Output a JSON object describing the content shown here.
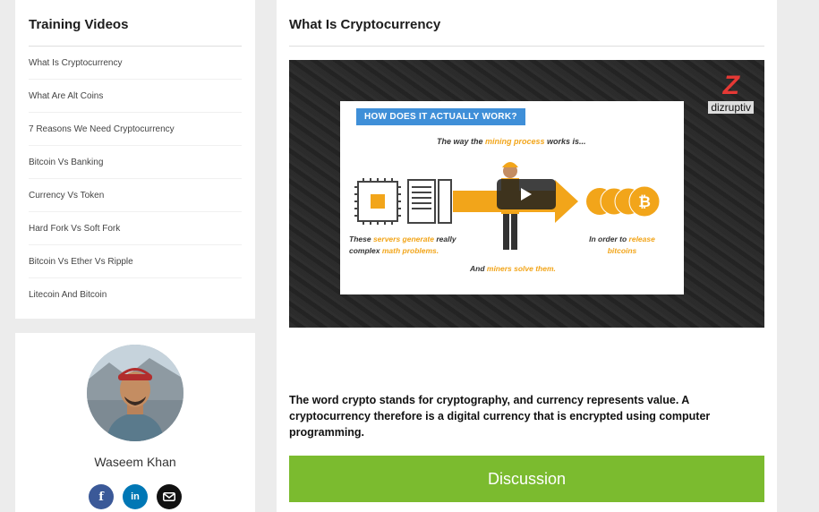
{
  "sidebar": {
    "title": "Training Videos",
    "items": [
      {
        "label": "What Is Cryptocurrency"
      },
      {
        "label": "What Are Alt Coins"
      },
      {
        "label": "7 Reasons We Need Cryptocurrency"
      },
      {
        "label": "Bitcoin Vs Banking"
      },
      {
        "label": "Currency Vs Token"
      },
      {
        "label": "Hard Fork Vs Soft Fork"
      },
      {
        "label": "Bitcoin Vs Ether Vs Ripple"
      },
      {
        "label": "Litecoin And Bitcoin"
      }
    ]
  },
  "profile": {
    "name": "Waseem Khan",
    "social": {
      "facebook_glyph": "f",
      "linkedin_glyph": "in",
      "email_icon": "envelope-icon"
    }
  },
  "main": {
    "title": "What Is Cryptocurrency",
    "video": {
      "logo_letter": "Z",
      "logo_text": "dizruptiv",
      "slide_heading": "HOW DOES IT ACTUALLY WORK?",
      "line1_prefix": "The way the ",
      "line1_highlight": "mining process",
      "line1_suffix": " works is...",
      "left_prefix": "These ",
      "left_highlight1": "servers generate",
      "left_mid": " really complex ",
      "left_highlight2": "math problems.",
      "right_prefix": "In order to ",
      "right_highlight": "release bitcoins",
      "bottom_prefix": "And ",
      "bottom_highlight": "miners solve them.",
      "play_icon": "play-icon"
    },
    "description": "The word crypto stands for cryptography, and currency represents value. A cryptocurrency therefore is a digital currency that is encrypted using computer programming.",
    "discussion_label": "Discussion"
  },
  "colors": {
    "accent_green": "#7bbb2f",
    "slide_blue": "#3f8fd8",
    "highlight_orange": "#f2a51a",
    "logo_red": "#e53935"
  }
}
